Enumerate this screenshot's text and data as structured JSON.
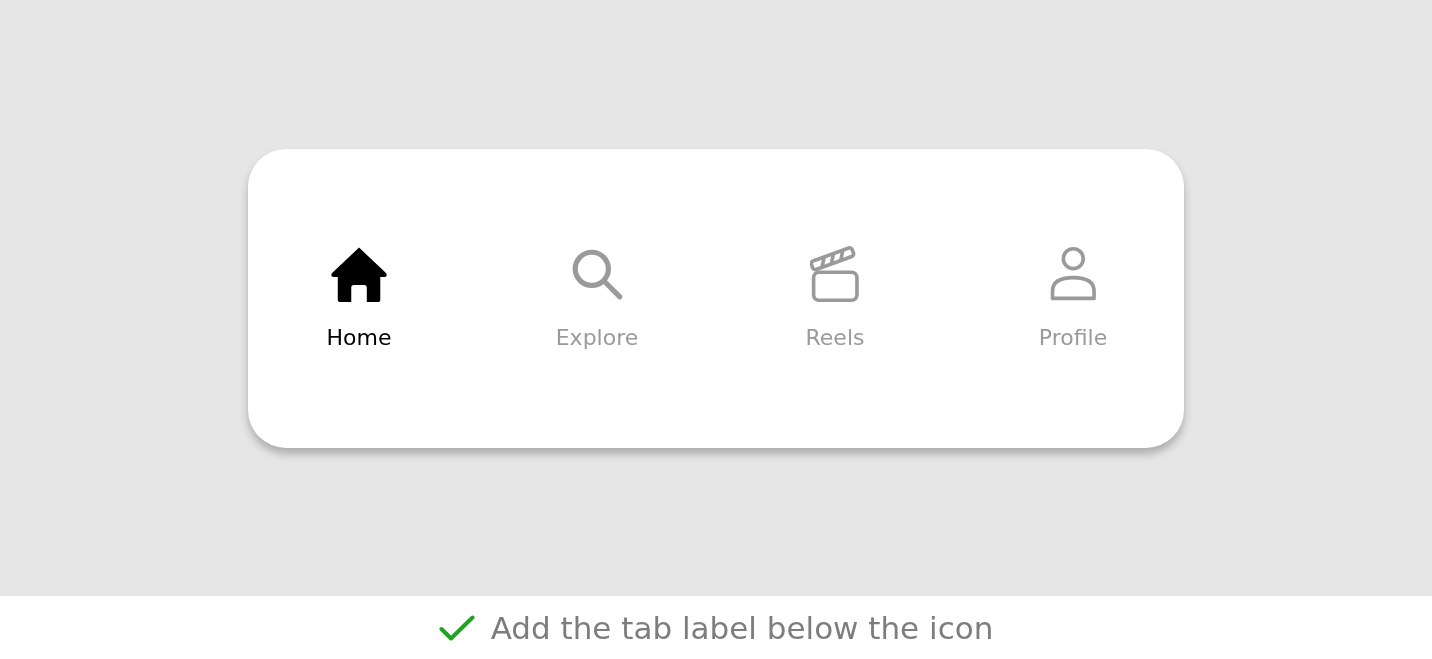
{
  "tab_bar": {
    "tabs": [
      {
        "kind": "home",
        "label": "Home",
        "selected": true
      },
      {
        "kind": "search",
        "label": "Explore",
        "selected": false
      },
      {
        "kind": "clapperboard",
        "label": "Reels",
        "selected": false
      },
      {
        "kind": "person",
        "label": "Profile",
        "selected": false
      }
    ]
  },
  "caption": {
    "text": "Add the tab label below the icon"
  }
}
